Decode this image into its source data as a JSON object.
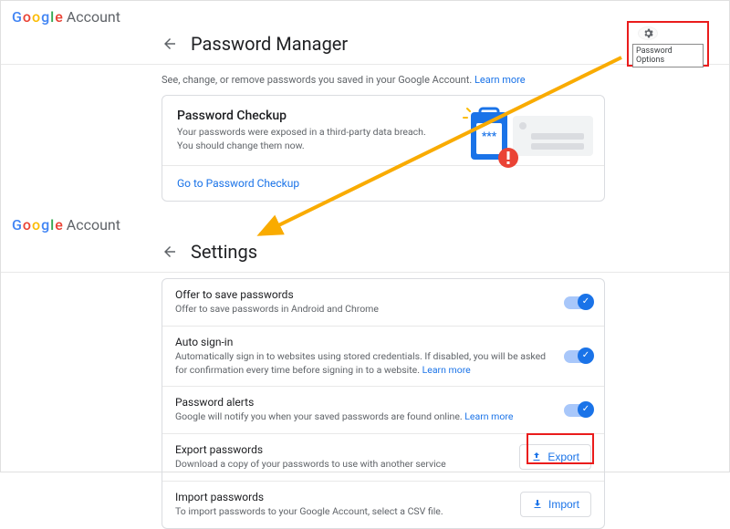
{
  "brand": {
    "g": "G",
    "o1": "o",
    "o2": "o",
    "g2": "g",
    "l": "l",
    "e": "e",
    "account": "Account"
  },
  "gear": {
    "tooltip": "Password Options"
  },
  "pm": {
    "title": "Password Manager",
    "subtext": "See, change, or remove passwords you saved in your Google Account.",
    "learn": "Learn more",
    "checkup_title": "Password Checkup",
    "checkup_desc": "Your passwords were exposed in a third-party data breach. You should change them now.",
    "checkup_link": "Go to Password Checkup"
  },
  "settings": {
    "title": "Settings",
    "rows": {
      "save": {
        "title": "Offer to save passwords",
        "desc": "Offer to save passwords in Android and Chrome"
      },
      "auto": {
        "title": "Auto sign-in",
        "desc": "Automatically sign in to websites using stored credentials. If disabled, you will be asked for confirmation every time before signing in to a website.",
        "learn": "Learn more"
      },
      "alerts": {
        "title": "Password alerts",
        "desc": "Google will notify you when your saved passwords are found online.",
        "learn": "Learn more"
      },
      "export": {
        "title": "Export passwords",
        "desc": "Download a copy of your passwords to use with another service",
        "btn": "Export"
      },
      "import": {
        "title": "Import passwords",
        "desc": "To import passwords to your Google Account, select a CSV file.",
        "btn": "Import"
      }
    }
  }
}
